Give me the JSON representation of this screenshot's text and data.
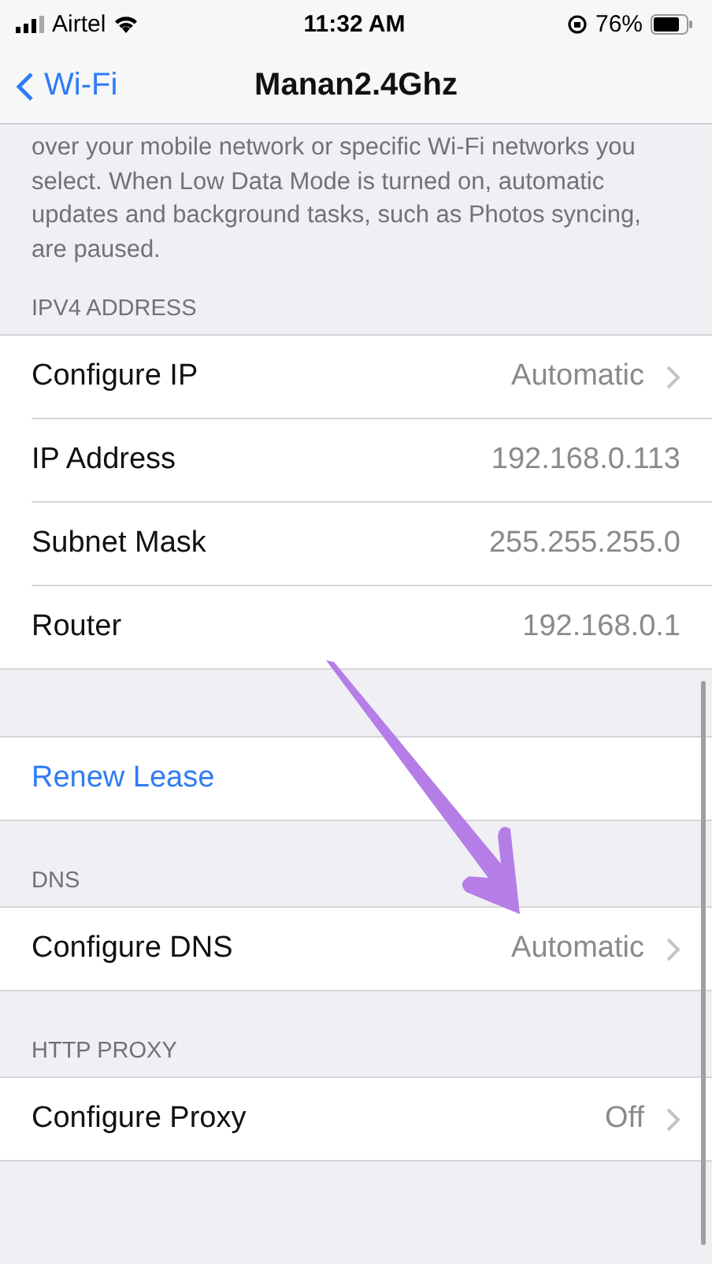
{
  "status_bar": {
    "carrier": "Airtel",
    "time": "11:32 AM",
    "battery": "76%"
  },
  "nav": {
    "back": "Wi-Fi",
    "title": "Manan2.4Ghz"
  },
  "description": "over your mobile network or specific Wi-Fi networks you select. When Low Data Mode is turned on, automatic updates and background tasks, such as Photos syncing, are paused.",
  "sections": [
    {
      "header": "IPV4 ADDRESS",
      "rows": [
        {
          "kind": "detail",
          "label": "Configure IP",
          "value": "Automatic",
          "chevron": true
        },
        {
          "kind": "detail",
          "label": "IP Address",
          "value": "192.168.0.113",
          "chevron": false
        },
        {
          "kind": "detail",
          "label": "Subnet Mask",
          "value": "255.255.255.0",
          "chevron": false
        },
        {
          "kind": "detail",
          "label": "Router",
          "value": "192.168.0.1",
          "chevron": false
        }
      ]
    },
    {
      "rows": [
        {
          "kind": "action",
          "label": "Renew Lease"
        }
      ]
    },
    {
      "header": "DNS",
      "rows": [
        {
          "kind": "detail",
          "label": "Configure DNS",
          "value": "Automatic",
          "chevron": true
        }
      ]
    },
    {
      "header": "HTTP PROXY",
      "rows": [
        {
          "kind": "detail",
          "label": "Configure Proxy",
          "value": "Off",
          "chevron": true
        }
      ]
    }
  ]
}
